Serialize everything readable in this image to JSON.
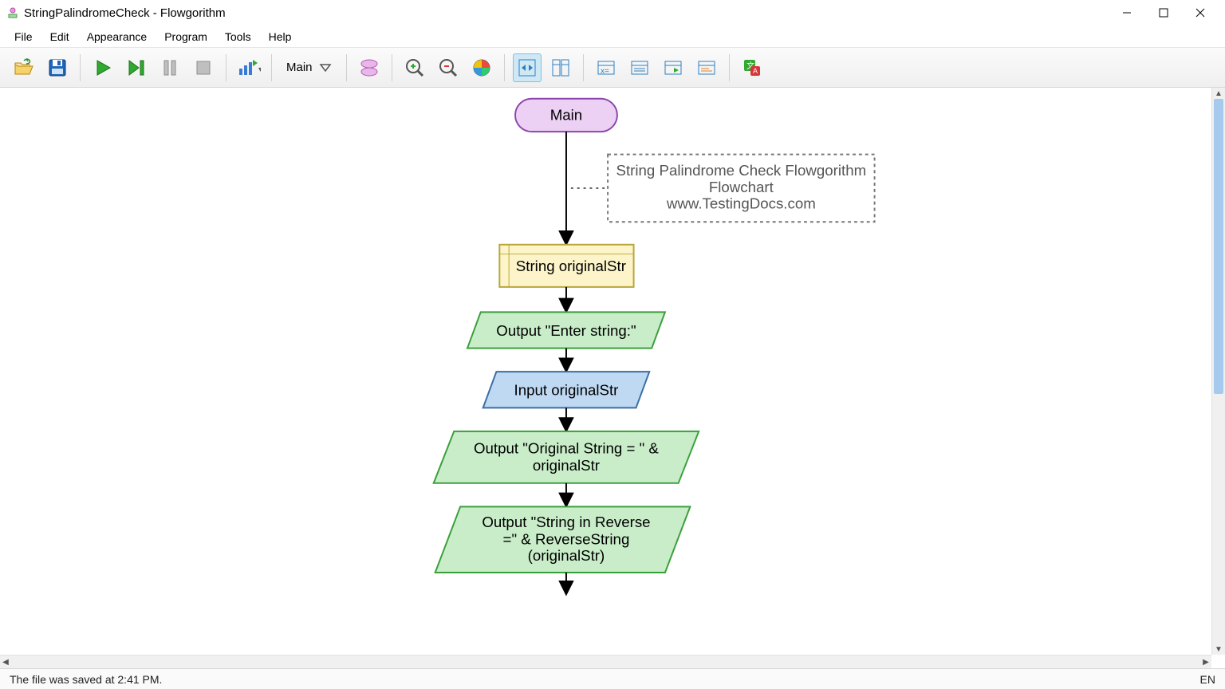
{
  "window": {
    "title": "StringPalindromeCheck - Flowgorithm"
  },
  "menu": {
    "file": "File",
    "edit": "Edit",
    "appearance": "Appearance",
    "program": "Program",
    "tools": "Tools",
    "help": "Help"
  },
  "toolbar": {
    "function": "Main"
  },
  "flowchart": {
    "terminal_main": "Main",
    "comment_line1": "String Palindrome Check Flowgorithm",
    "comment_line2": "Flowchart",
    "comment_line3": "www.TestingDocs.com",
    "declare": "String originalStr",
    "output_prompt": "Output \"Enter string:\"",
    "input": "Input originalStr",
    "output_original_l1": "Output \"Original String = \" &",
    "output_original_l2": "originalStr",
    "output_reverse_l1": "Output \"String in Reverse",
    "output_reverse_l2": "=\" & ReverseString",
    "output_reverse_l3": "(originalStr)"
  },
  "status": {
    "message": "The file was saved at 2:41 PM.",
    "lang": "EN"
  }
}
